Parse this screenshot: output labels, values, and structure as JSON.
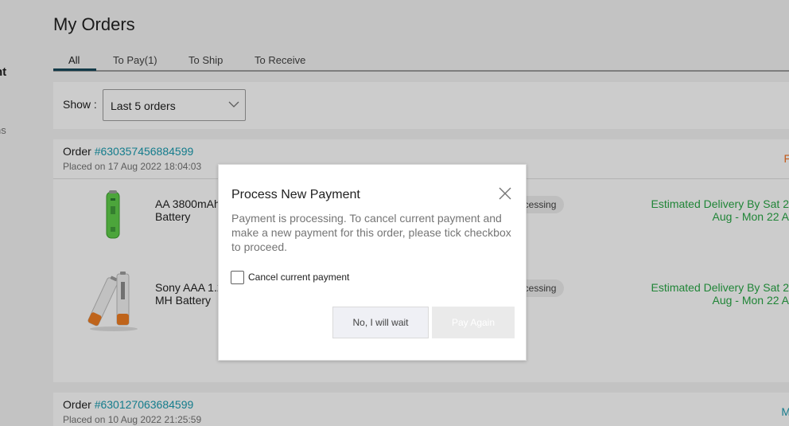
{
  "sidebar": {
    "account_label": "nt",
    "returns_label": "ns"
  },
  "page": {
    "title": "My Orders"
  },
  "tabs": [
    {
      "label": "All",
      "active": true
    },
    {
      "label": "To Pay(1)",
      "active": false
    },
    {
      "label": "To Ship",
      "active": false
    },
    {
      "label": "To Receive",
      "active": false
    }
  ],
  "filter": {
    "label": "Show :",
    "selected": "Last 5 orders"
  },
  "orders": [
    {
      "prefix": "Order ",
      "number": "#630357456884599",
      "placed": "Placed on 17 Aug 2022 18:04:03",
      "right_fragment": "F",
      "items": [
        {
          "name": "AA 3800mAh Battery",
          "status": "ocessing",
          "delivery_line1": "Estimated Delivery By Sat 2",
          "delivery_line2": "Aug - Mon 22 A"
        },
        {
          "name": "Sony AAA 1.2 MH Battery",
          "status": "ocessing",
          "delivery_line1": "Estimated Delivery By Sat 2",
          "delivery_line2": "Aug - Mon 22 A"
        }
      ]
    },
    {
      "prefix": "Order ",
      "number": "#630127063684599",
      "placed": "Placed on 10 Aug 2022 21:25:59",
      "right_fragment": "M"
    }
  ],
  "modal": {
    "title": "Process New Payment",
    "message": "Payment is processing. To cancel current payment and make a new payment for this order, please tick checkbox to proceed.",
    "checkbox_label": "Cancel current payment",
    "checkbox_checked": false,
    "wait_button": "No, I will wait",
    "pay_button": "Pay Again",
    "pay_button_enabled": false
  },
  "icons": {
    "close": "close-icon",
    "chevron": "chevron-down-icon"
  },
  "colors": {
    "link": "#1a9cb0",
    "delivery": "#28a745",
    "tab_underline": "#1a4a5c",
    "pending": "#f57224"
  }
}
